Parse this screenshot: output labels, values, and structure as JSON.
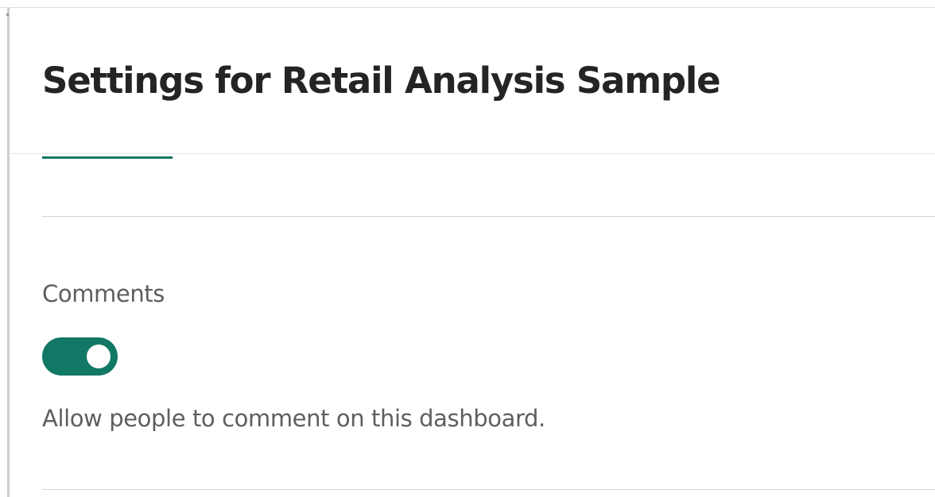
{
  "page": {
    "title": "Settings for Retail Analysis Sample"
  },
  "comments_section": {
    "label": "Comments",
    "toggle_state": "on",
    "description": "Allow people to comment on this dashboard."
  },
  "colors": {
    "accent": "#117865",
    "title_text": "#252423",
    "secondary_text": "#605e5c"
  }
}
